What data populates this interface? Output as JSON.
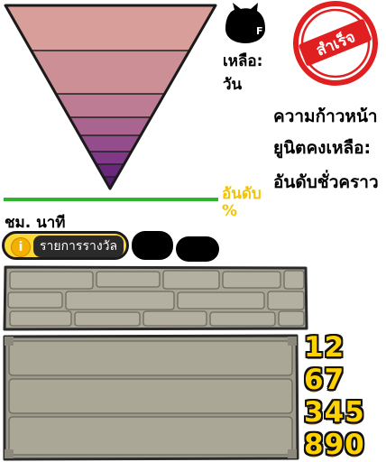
{
  "status": {
    "remaining_label": "เหลือ:",
    "remaining_unit": "วัน",
    "stamp_text": "สำเร็จ",
    "progress_label": "ความก้าวหน้า",
    "units_left_label": "ยูนิตคงเหลือ:",
    "temp_rank_label": "อันดับชั่วคราว",
    "rank_text": "อันดับ %",
    "hour_text": "ชม. นาที"
  },
  "buttons": {
    "rewards_label": "รายการรางวัล",
    "info_glyph": "i"
  },
  "digits": {
    "row1": "12",
    "row2": "67",
    "row3": "345",
    "row4": "890"
  },
  "colors": {
    "triangle_stripes": [
      "#d89f9a",
      "#cc8f95",
      "#bd7c94",
      "#a96490",
      "#944d8c",
      "#7f3986",
      "#6a287d",
      "#581c73"
    ],
    "progress_line": "#2fb52f",
    "stamp_red": "#e02020",
    "digit_yellow": "#ffd200",
    "button_yellow": "#fdd835"
  },
  "icons": {
    "cat": "cat-silhouette-icon",
    "info": "info-icon"
  }
}
